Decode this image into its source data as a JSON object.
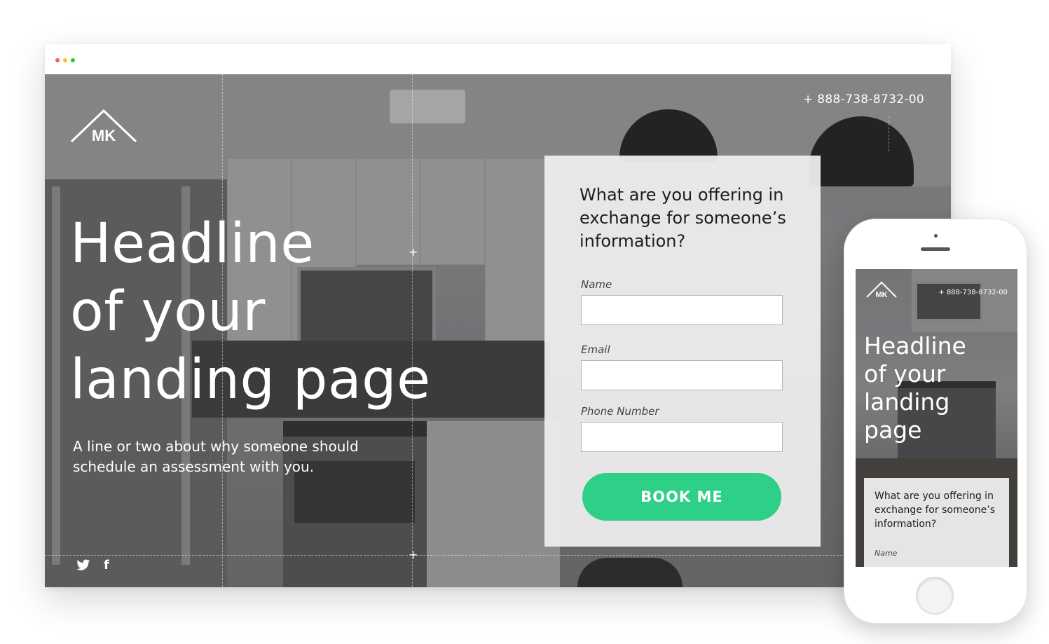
{
  "browser": {
    "traffic_lights": [
      "#ff5f57",
      "#febc2e",
      "#28c840"
    ]
  },
  "landing": {
    "phone": "+ 888-738-8732-00",
    "logo_text": "MK",
    "headline": [
      "Headline",
      "of your",
      "landing page"
    ],
    "subtext": "A line or two about why someone should schedule an assessment with you.",
    "social_icons": [
      "twitter-icon",
      "facebook-icon"
    ],
    "twitter_glyph": "✓",
    "facebook_glyph": "f"
  },
  "form": {
    "title": "What are you offering in exchange for someone’s information?",
    "fields": [
      {
        "label": "Name",
        "value": ""
      },
      {
        "label": "Email",
        "value": ""
      },
      {
        "label": "Phone Number",
        "value": ""
      }
    ],
    "button": "BOOK ME",
    "button_color": "#2ecf87"
  },
  "mobile": {
    "phone": "+ 888-738-8732-00",
    "logo_text": "MK",
    "headline": [
      "Headline",
      "of your",
      "landing",
      "page"
    ],
    "form_title": "What are you offering in exchange for someone’s information?",
    "first_field_label": "Name"
  }
}
